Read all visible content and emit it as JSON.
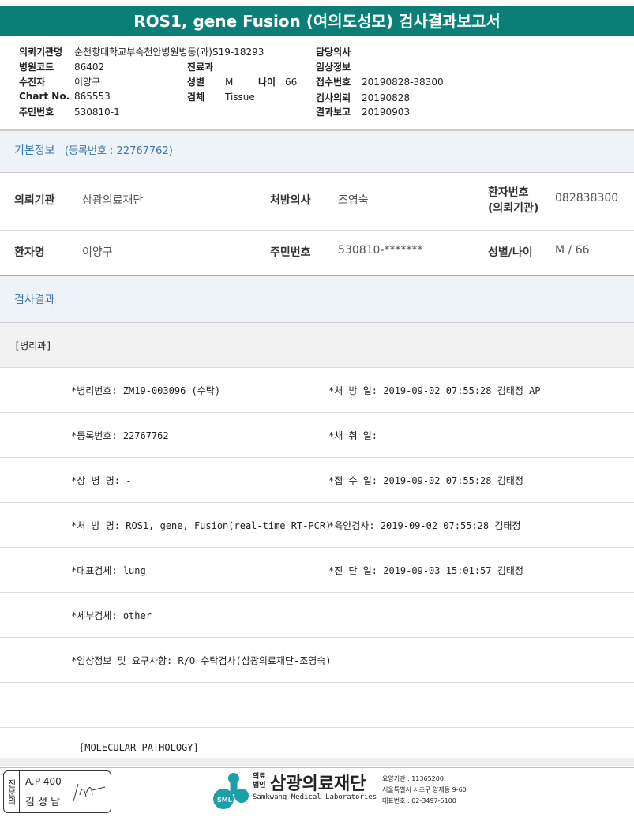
{
  "title": "ROS1, gene Fusion (여의도성모) 검사결과보고서",
  "header": {
    "inst_label": "의뢰기관명",
    "inst_value": "순천향대학교부속천안병원병동(과)S19-18293",
    "code_label": "병원코드",
    "code_value": "86402",
    "patient_label": "수진자",
    "patient_value": "이양구",
    "chart_label": "Chart No.",
    "chart_value": "865553",
    "id_label": "주민번호",
    "id_value": "530810-1",
    "dept_label": "진료과",
    "sex_label": "성별",
    "sex_value": "M",
    "age_label": "나이",
    "age_value": "66",
    "specimen_label": "검체",
    "specimen_value": "Tissue",
    "doctor_label": "담당의사",
    "clinical_label": "임상정보",
    "receipt_label": "접수번호",
    "receipt_value": "20190828-38300",
    "request_label": "검사의뢰",
    "request_value": "20190828",
    "report_label": "결과보고",
    "report_value": "20190903"
  },
  "basic": {
    "title": "기본정보",
    "reg": "(등록번호 : 22767762)",
    "inst_label": "의뢰기관",
    "inst_value": "삼광의료재단",
    "doc_label": "처방의사",
    "doc_value": "조영숙",
    "pno_label1": "환자번호",
    "pno_label2": "(의뢰기관)",
    "pno_value": "082838300",
    "name_label": "환자명",
    "name_value": "이양구",
    "rrn_label": "주민번호",
    "rrn_value": "530810-*******",
    "sexage_label": "성별/나이",
    "sexage_value": "M / 66"
  },
  "result": {
    "title": "검사결과",
    "dept": "[병리과]",
    "rows": [
      [
        "*병리번호: ZM19-003096 (수탁)",
        "*처 방 일: 2019-09-02 07:55:28  김태정 AP"
      ],
      [
        "*등록번호: 22767762",
        "*채 취 일:"
      ],
      [
        "*상 병 명: -",
        "*접 수 일: 2019-09-02 07:55:28  김태정"
      ],
      [
        "*처 방 명: ROS1, gene, Fusion(real-time RT-PCR)",
        "*육안검사: 2019-09-02 07:55:28  김태정"
      ],
      [
        "*대표검체: lung",
        "*진 단 일: 2019-09-03 15:01:57  김태정"
      ],
      [
        "*세부검체: other",
        ""
      ],
      [
        "*임상정보 및 요구사항: R/O 수탁검사(삼광의료재단-조영숙)",
        ""
      ]
    ],
    "molecular": "[MOLECULAR PATHOLOGY]"
  },
  "footer": {
    "specialist": "전문의",
    "ap": "A.P 400",
    "name": "김 성 남",
    "logo_prefix1": "의료",
    "logo_prefix2": "법인",
    "logo_name": "삼광의료재단",
    "logo_en": "Samkwang Medical Laboratories",
    "logo_mark": "SML",
    "code": "요양기관 : 11365200",
    "address": "서울특별시 서초구 양재동 9-60",
    "phone": "대표번호 : 02-3497-5100"
  }
}
